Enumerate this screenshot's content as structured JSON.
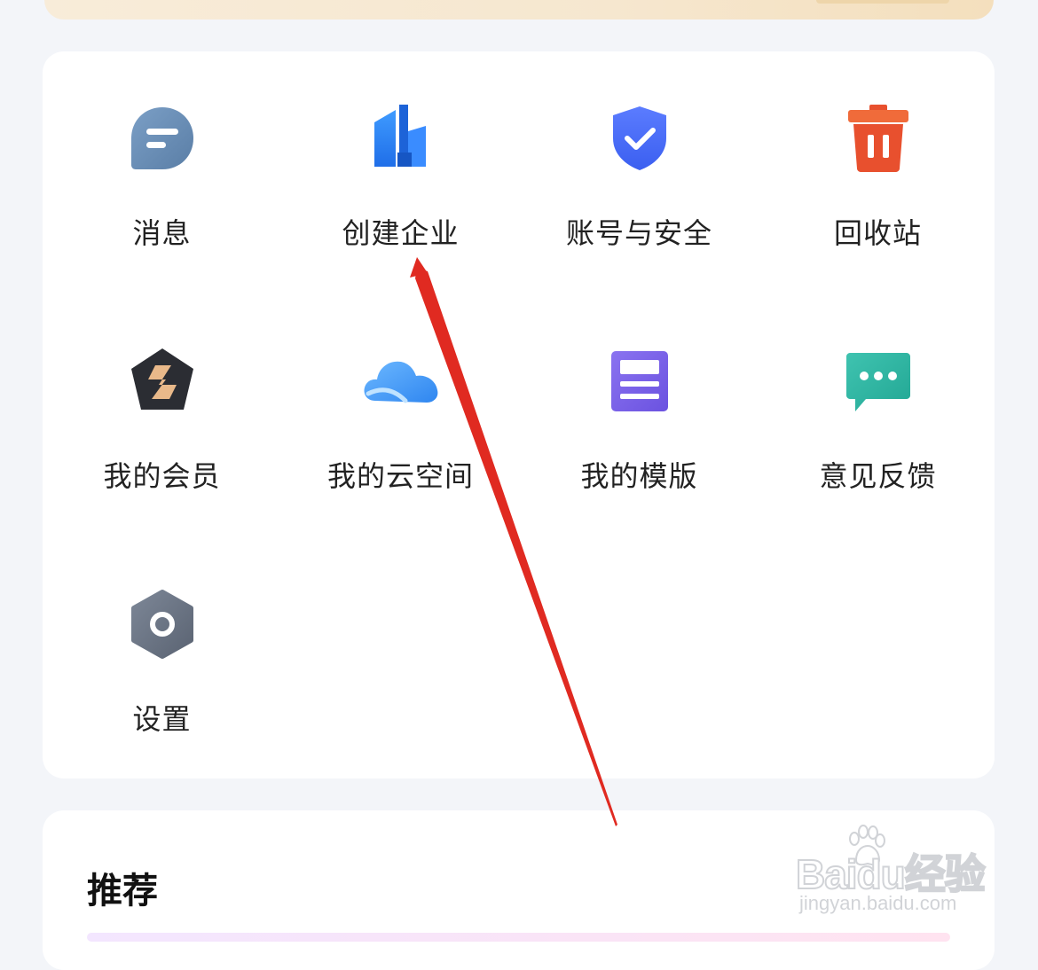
{
  "tools": {
    "items": [
      {
        "label": "消息",
        "icon": "message-icon"
      },
      {
        "label": "创建企业",
        "icon": "building-icon"
      },
      {
        "label": "账号与安全",
        "icon": "shield-check-icon"
      },
      {
        "label": "回收站",
        "icon": "trash-icon"
      },
      {
        "label": "我的会员",
        "icon": "vip-badge-icon"
      },
      {
        "label": "我的云空间",
        "icon": "cloud-icon"
      },
      {
        "label": "我的模版",
        "icon": "template-icon"
      },
      {
        "label": "意见反馈",
        "icon": "feedback-chat-icon"
      },
      {
        "label": "设置",
        "icon": "gear-icon"
      }
    ]
  },
  "recommend": {
    "title": "推荐"
  },
  "watermark": {
    "brand": "Baidu经验",
    "url": "jingyan.baidu.com"
  },
  "colors": {
    "annotation_arrow": "#e02a21",
    "page_background": "#f3f5f9",
    "card_background": "#ffffff"
  }
}
